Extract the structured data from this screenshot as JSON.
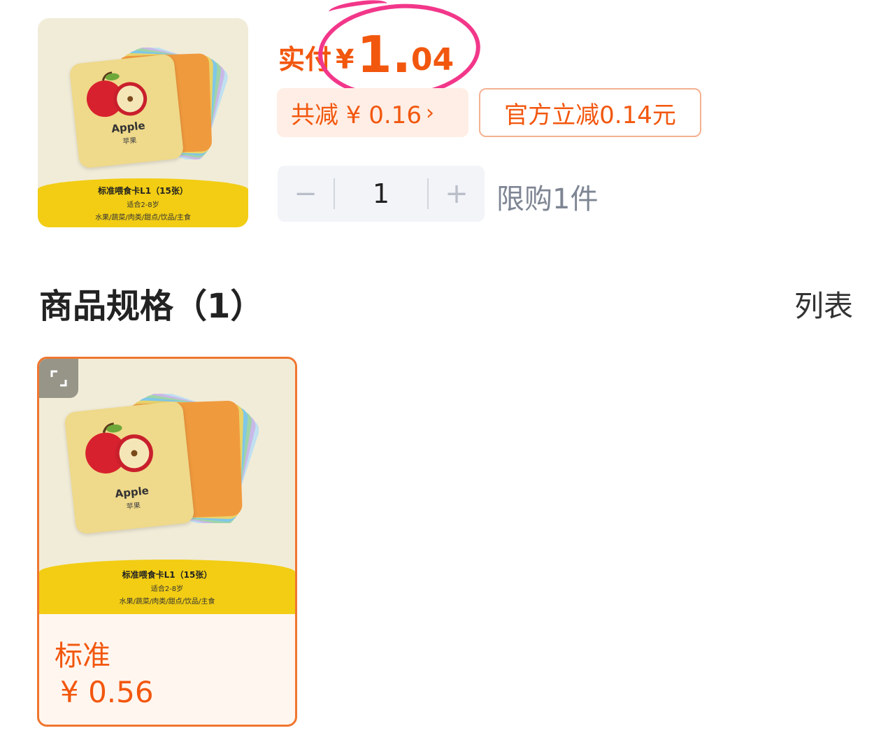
{
  "product": {
    "image": {
      "card_word": "Apple",
      "card_cn": "苹果",
      "band_title": "标准喂食卡L1（15张）",
      "band_age": "适合2-8岁",
      "band_categories": "水果/蔬菜/肉类/甜点/饮品/主食"
    },
    "price": {
      "label": "实付",
      "currency": "¥",
      "integer": "1.",
      "decimal": "04"
    },
    "discount": {
      "total_label": "共减 ¥ 0.16",
      "arrow": "›",
      "official_label": "官方立减0.14元"
    },
    "quantity": {
      "minus": "−",
      "value": "1",
      "plus": "+",
      "limit": "限购1件"
    }
  },
  "specs": {
    "title": "商品规格（1）",
    "view_toggle": "列表",
    "items": [
      {
        "name": "标准",
        "price": "¥ 0.56",
        "image": {
          "card_word": "Apple",
          "card_cn": "苹果",
          "band_title": "标准喂食卡L1（15张）",
          "band_age": "适合2-8岁",
          "band_categories": "水果/蔬菜/肉类/甜点/饮品/主食"
        }
      }
    ]
  },
  "colors": {
    "accent": "#f2570e",
    "highlight_circle": "#f2378a",
    "selected_border": "#f0762f",
    "band_yellow": "#f2cd14"
  },
  "icons": {
    "expand": "expand-icon"
  }
}
